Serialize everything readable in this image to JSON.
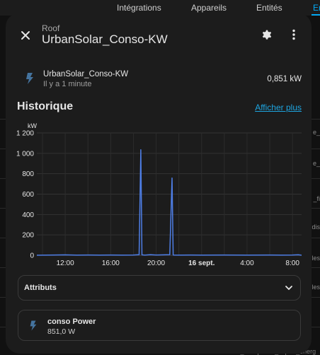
{
  "background": {
    "tabs": [
      "Intégrations",
      "Appareils",
      "Entités",
      "Er"
    ],
    "right_fragments": [
      "e_",
      "e_",
      "_fi",
      "dis",
      "les",
      "les"
    ],
    "bottom_fragment": "consocurban_sunspease_import_energ"
  },
  "dialog": {
    "subtitle": "Roof",
    "title": "UrbanSolar_Conso-KW"
  },
  "entity": {
    "icon": "flash-icon",
    "name": "UrbanSolar_Conso-KW",
    "last_changed": "Il y a 1 minute",
    "state": "0,851 kW"
  },
  "history": {
    "title": "Historique",
    "show_more": "Afficher plus"
  },
  "chart_data": {
    "type": "line",
    "ylabel": "kW",
    "ylim": [
      0,
      1200
    ],
    "yticks": [
      "0",
      "200",
      "400",
      "600",
      "800",
      "1 000",
      "1 200"
    ],
    "xticks": [
      "12:00",
      "16:00",
      "20:00",
      "16 sept.",
      "4:00",
      "8:00"
    ],
    "bold_xticks": [
      "16 sept."
    ],
    "x_range_hours": [
      9.5,
      32.8
    ],
    "color": "#4e7ee6",
    "grid": true,
    "series": [
      {
        "points": [
          [
            9.5,
            1
          ],
          [
            11.0,
            3
          ],
          [
            12.0,
            4
          ],
          [
            13.0,
            2
          ],
          [
            14.0,
            3
          ],
          [
            15.0,
            2
          ],
          [
            16.0,
            3
          ],
          [
            17.0,
            2
          ],
          [
            18.0,
            3
          ],
          [
            18.5,
            6
          ],
          [
            18.65,
            1035
          ],
          [
            18.75,
            4
          ],
          [
            19.0,
            2
          ],
          [
            19.5,
            6
          ],
          [
            20.0,
            3
          ],
          [
            21.2,
            6
          ],
          [
            21.4,
            758
          ],
          [
            21.5,
            3
          ],
          [
            22.0,
            2
          ],
          [
            23.0,
            3
          ],
          [
            24.0,
            2
          ],
          [
            26.0,
            3
          ],
          [
            28.0,
            2
          ],
          [
            30.0,
            3
          ],
          [
            31.0,
            2
          ],
          [
            32.0,
            3
          ],
          [
            32.5,
            5
          ],
          [
            32.8,
            1
          ]
        ]
      }
    ]
  },
  "attributes": {
    "label": "Attributs"
  },
  "sub_entity": {
    "icon": "flash-icon",
    "name": "conso Power",
    "value": "851,0 W"
  },
  "colors": {
    "accent": "#03a9f4",
    "link": "#1ea5e0",
    "icon": "#44739e",
    "line": "#4e7ee6"
  }
}
